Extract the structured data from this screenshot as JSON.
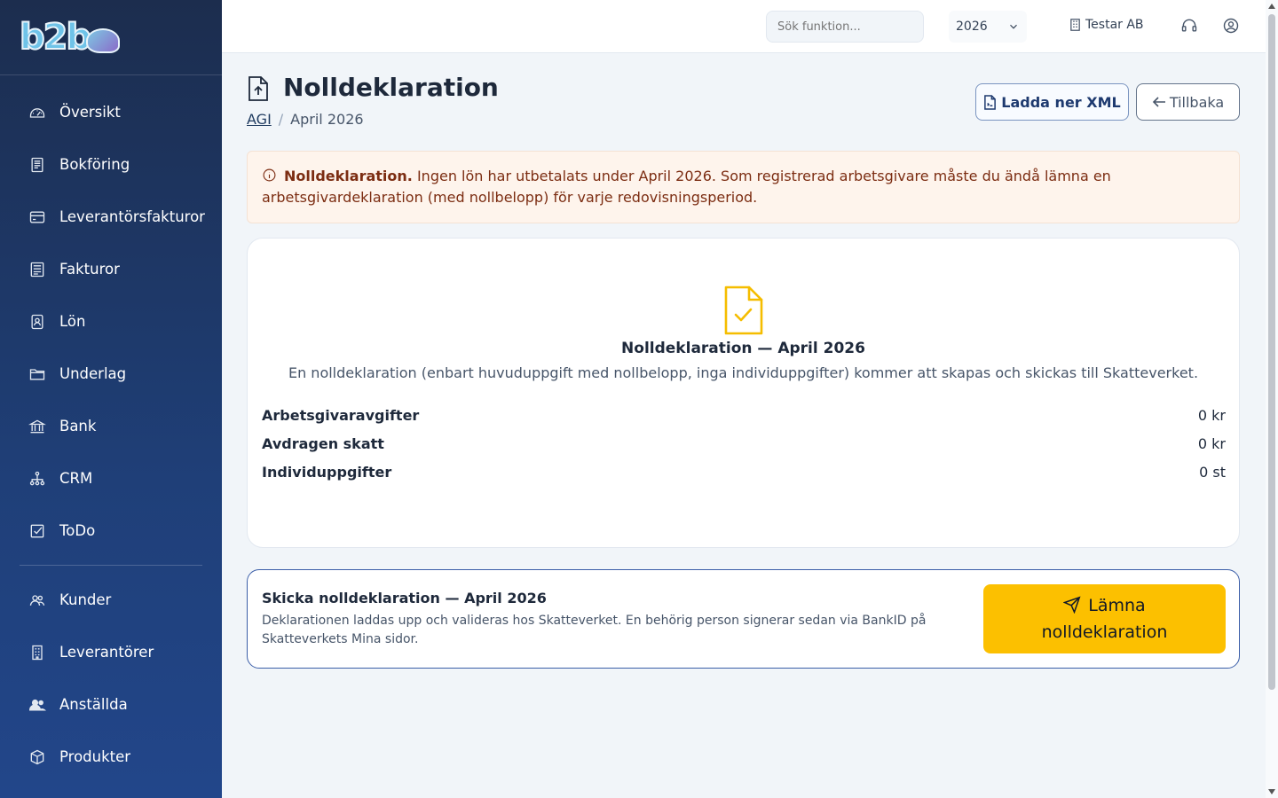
{
  "sidebar": {
    "logo": "b2b",
    "items": [
      {
        "label": "Översikt",
        "icon": "gauge-icon"
      },
      {
        "label": "Bokföring",
        "icon": "ledger-icon"
      },
      {
        "label": "Leverantörsfakturor",
        "icon": "credit-card-icon"
      },
      {
        "label": "Fakturor",
        "icon": "invoice-icon"
      },
      {
        "label": "Lön",
        "icon": "payroll-icon"
      },
      {
        "label": "Underlag",
        "icon": "folder-icon"
      },
      {
        "label": "Bank",
        "icon": "bank-icon"
      },
      {
        "label": "CRM",
        "icon": "network-icon"
      },
      {
        "label": "ToDo",
        "icon": "checkbox-icon"
      }
    ],
    "items2": [
      {
        "label": "Kunder",
        "icon": "customers-icon"
      },
      {
        "label": "Leverantörer",
        "icon": "building-icon"
      },
      {
        "label": "Anställda",
        "icon": "employees-icon"
      },
      {
        "label": "Produkter",
        "icon": "box-icon"
      }
    ]
  },
  "topbar": {
    "search_placeholder": "Sök funktion...",
    "year": "2026",
    "company": "Testar AB"
  },
  "page": {
    "title": "Nolldeklaration",
    "breadcrumb_link": "AGI",
    "breadcrumb_current": "April 2026",
    "download_label": "Ladda ner XML",
    "back_label": "Tillbaka"
  },
  "alert": {
    "strong": "Nolldeklaration.",
    "text": "Ingen lön har utbetalats under April 2026. Som registrerad arbetsgivare måste du ändå lämna en arbetsgivardeklaration (med nollbelopp) för varje redovisningsperiod."
  },
  "summary": {
    "title": "Nolldeklaration — April 2026",
    "subtitle": "En nolldeklaration (enbart huvuduppgift med nollbelopp, inga individuppgifter) kommer att skapas och skickas till Skatteverket.",
    "rows": [
      {
        "label": "Arbetsgivaravgifter",
        "value": "0 kr"
      },
      {
        "label": "Avdragen skatt",
        "value": "0 kr"
      },
      {
        "label": "Individuppgifter",
        "value": "0 st"
      }
    ]
  },
  "submit": {
    "title": "Skicka nolldeklaration — April 2026",
    "description": "Deklarationen laddas upp och valideras hos Skatteverket. En behörig person signerar sedan via BankID på Skatteverkets Mina sidor.",
    "button_line1": "Lämna",
    "button_line2": "nolldeklaration"
  },
  "colors": {
    "sidebar_top": "#1c2d4e",
    "sidebar_bottom": "#22468a",
    "accent_yellow": "#fcc000",
    "alert_bg": "#fef4ec",
    "alert_text": "#7c2d12"
  }
}
